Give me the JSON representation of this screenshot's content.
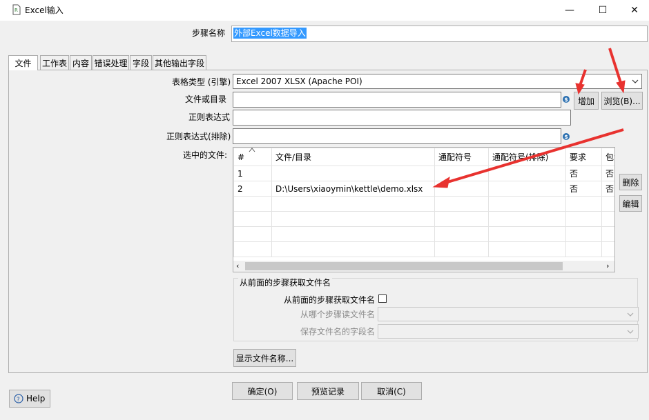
{
  "window": {
    "title": "Excel输入",
    "minimize": "—",
    "maximize": "☐",
    "close": "✕"
  },
  "step_name": {
    "label": "步骤名称",
    "value": "外部Excel数据导入"
  },
  "tabs": [
    {
      "label": "文件"
    },
    {
      "label": "工作表"
    },
    {
      "label": "内容"
    },
    {
      "label": "错误处理"
    },
    {
      "label": "字段"
    },
    {
      "label": "其他输出字段"
    }
  ],
  "file_tab": {
    "spreadsheet_type": {
      "label": "表格类型 (引擎)",
      "value": "Excel 2007 XLSX (Apache POI)"
    },
    "file_or_dir": {
      "label": "文件或目录",
      "value": ""
    },
    "regex": {
      "label": "正则表达式",
      "value": ""
    },
    "regex_exclude": {
      "label": "正则表达式(排除)",
      "value": ""
    },
    "selected_files_label": "选中的文件:",
    "add_button": "增加",
    "browse_button": "浏览(B)...",
    "delete_button": "删除",
    "edit_button": "编辑",
    "table": {
      "headers": [
        "#",
        "文件/目录",
        "通配符号",
        "通配符号(排除)",
        "要求",
        "包含子目录"
      ],
      "rows": [
        [
          "1",
          "",
          "",
          "",
          "否",
          "否"
        ],
        [
          "2",
          "D:\\Users\\xiaoymin\\kettle\\demo.xlsx",
          "",
          "",
          "否",
          "否"
        ]
      ]
    },
    "prev_group": {
      "title": "从前面的步骤获取文件名",
      "accept_label": "从前面的步骤获取文件名",
      "step_label": "从哪个步骤读文件名",
      "field_label": "保存文件名的字段名"
    },
    "show_filenames_button": "显示文件名称..."
  },
  "footer": {
    "ok": "确定(O)",
    "preview": "预览记录",
    "cancel": "取消(C)",
    "help": "Help"
  },
  "colors": {
    "selection": "#3399ff",
    "arrow": "#e8322f",
    "info_icon": "#2a6fb0"
  }
}
